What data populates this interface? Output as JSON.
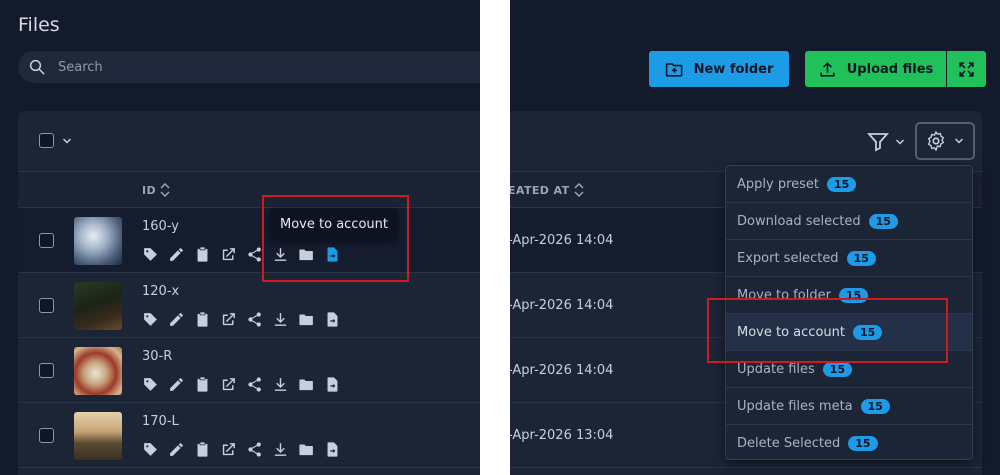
{
  "page": {
    "title": "Files"
  },
  "search": {
    "placeholder": "Search"
  },
  "toolbar": {
    "new_folder": "New folder",
    "upload_files": "Upload files"
  },
  "table": {
    "columns": {
      "id": "ID",
      "created_at": "EATED AT"
    },
    "rows": [
      {
        "name": "160-y",
        "date": "-Apr-2026 14:04"
      },
      {
        "name": "120-x",
        "date": "-Apr-2026 14:04"
      },
      {
        "name": "30-R",
        "date": "-Apr-2026 14:04"
      },
      {
        "name": "170-L",
        "date": "-Apr-2026 13:04"
      }
    ]
  },
  "tooltip": {
    "text": "Move to account"
  },
  "dropdown": {
    "items": [
      {
        "label": "Apply preset",
        "count": "15"
      },
      {
        "label": "Download selected",
        "count": "15"
      },
      {
        "label": "Export selected",
        "count": "15"
      },
      {
        "label": "Move to folder",
        "count": "15"
      },
      {
        "label": "Move to account",
        "count": "15"
      },
      {
        "label": "Update files",
        "count": "15"
      },
      {
        "label": "Update files meta",
        "count": "15"
      },
      {
        "label": "Delete Selected",
        "count": "15"
      }
    ]
  },
  "colors": {
    "accent_blue": "#1e9be6",
    "accent_green": "#20c15a",
    "highlight_red": "#cf1a21",
    "background": "#121a2c"
  }
}
